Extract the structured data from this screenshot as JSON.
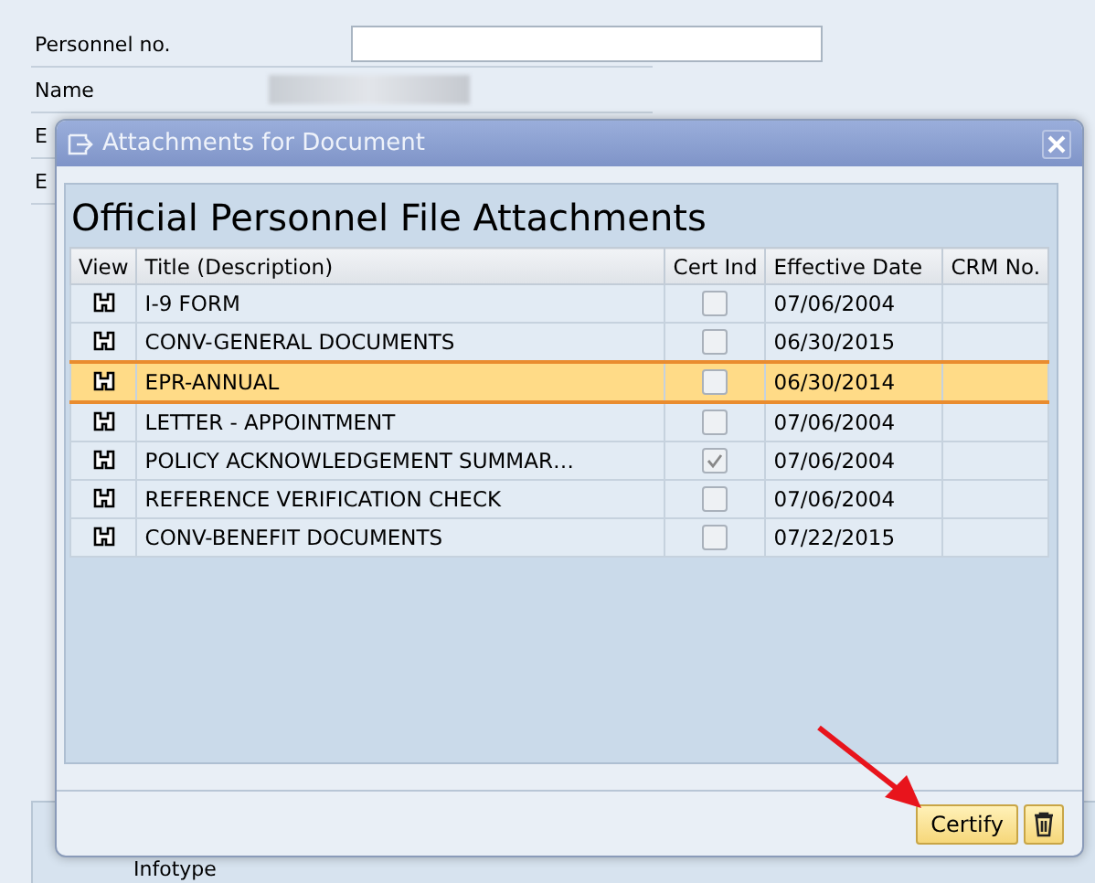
{
  "background": {
    "fields": [
      {
        "label": "Personnel no.",
        "kind": "input"
      },
      {
        "label": "Name",
        "kind": "display"
      },
      {
        "label": "E",
        "kind": "none"
      },
      {
        "label": "E",
        "kind": "none"
      }
    ],
    "bottom_label": "Infotype"
  },
  "dialog": {
    "title": "Attachments for Document",
    "heading": "Official Personnel File Attachments",
    "table": {
      "columns": [
        "View",
        "Title (Description)",
        "Cert Ind",
        "Effective Date",
        "CRM No."
      ],
      "rows": [
        {
          "title": "I-9 FORM",
          "cert": false,
          "date": "07/06/2004",
          "selected": false
        },
        {
          "title": "CONV-GENERAL DOCUMENTS",
          "cert": false,
          "date": "06/30/2015",
          "selected": false
        },
        {
          "title": "EPR-ANNUAL",
          "cert": false,
          "date": "06/30/2014",
          "selected": true
        },
        {
          "title": "LETTER - APPOINTMENT",
          "cert": false,
          "date": "07/06/2004",
          "selected": false
        },
        {
          "title": "POLICY ACKNOWLEDGEMENT SUMMAR…",
          "cert": true,
          "date": "07/06/2004",
          "selected": false
        },
        {
          "title": "REFERENCE VERIFICATION CHECK",
          "cert": false,
          "date": "07/06/2004",
          "selected": false
        },
        {
          "title": "CONV-BENEFIT DOCUMENTS",
          "cert": false,
          "date": "07/22/2015",
          "selected": false
        }
      ]
    },
    "buttons": [
      {
        "kind": "text",
        "label": "Certify"
      },
      {
        "kind": "trash"
      }
    ]
  }
}
